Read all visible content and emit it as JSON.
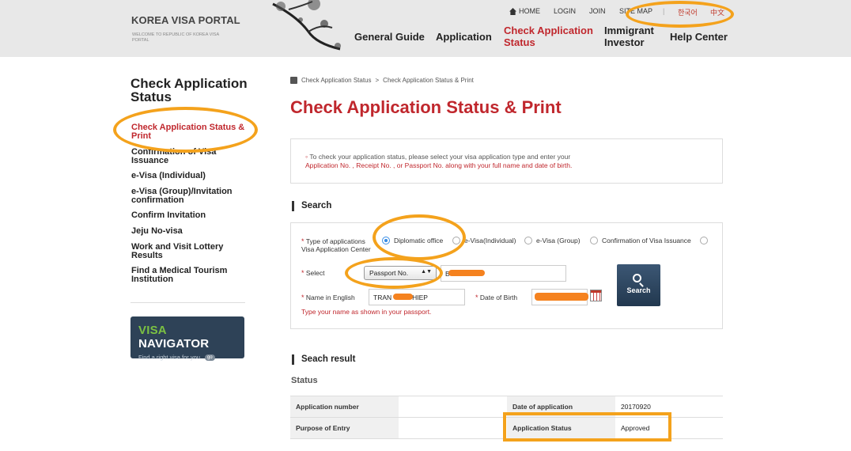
{
  "header": {
    "logo": "KOREA VISA PORTAL",
    "logo_sub": "WELCOME TO REPUBLIC OF KOREA VISA PORTAL",
    "util": {
      "home": "HOME",
      "login": "LOGIN",
      "join": "JOIN",
      "sitemap": "SITE MAP",
      "lang_ko": "한국어",
      "lang_zh": "中文"
    },
    "gnb": [
      "General Guide",
      "Application",
      "Check Application Status",
      "Immigrant Investor",
      "Help Center"
    ]
  },
  "sidebar": {
    "title": "Check Application Status",
    "items": [
      "Check Application Status & Print",
      "Confirmation of Visa Issuance",
      "e-Visa (Individual)",
      "e-Visa (Group)/Invitation confirmation",
      "Confirm Invitation",
      "Jeju No-visa",
      "Work and Visit Lottery Results",
      "Find a Medical Tourism Institution"
    ],
    "banner": {
      "title_accent": "VISA",
      "title_rest": " NAVIGATOR",
      "sub": "Find a right visa for you",
      "go": "go"
    }
  },
  "main": {
    "breadcrumb": [
      "Check Application Status",
      ">",
      "Check Application Status & Print"
    ],
    "title": "Check Application Status & Print",
    "notice_line1": "To check your application status, please select your visa application type and enter your",
    "notice_line2": "Application No. , Receipt No. , or Passport No. along with your full name and date of birth.",
    "search_heading": "Search",
    "form": {
      "type_label": "Type of applications",
      "type_options": [
        "Diplomatic office",
        "e-Visa(Individual)",
        "e-Visa (Group)",
        "Confirmation of Visa Issuance",
        "Visa Application Center"
      ],
      "selected_type": "Diplomatic office",
      "select_label": "Select",
      "select_value": "Passport No.",
      "passport_value": "B",
      "name_label": "Name in English",
      "name_value_1": "TRAN",
      "name_value_2": "HIEP",
      "dob_label": "Date of Birth",
      "hint": "Type your name as shown in your passport.",
      "search_button": "Search"
    },
    "result_heading": "Seach result",
    "status_label": "Status",
    "result": {
      "app_number_label": "Application number",
      "app_number_value": "",
      "date_label": "Date of application",
      "date_value": "20170920",
      "purpose_label": "Purpose of Entry",
      "purpose_value": "",
      "status_label": "Application Status",
      "status_value": "Approved"
    }
  },
  "colors": {
    "accent_red": "#c0272d",
    "highlight_orange": "#f4a21c",
    "redaction_orange": "#f5821f",
    "button_navy": "#2e4257"
  }
}
